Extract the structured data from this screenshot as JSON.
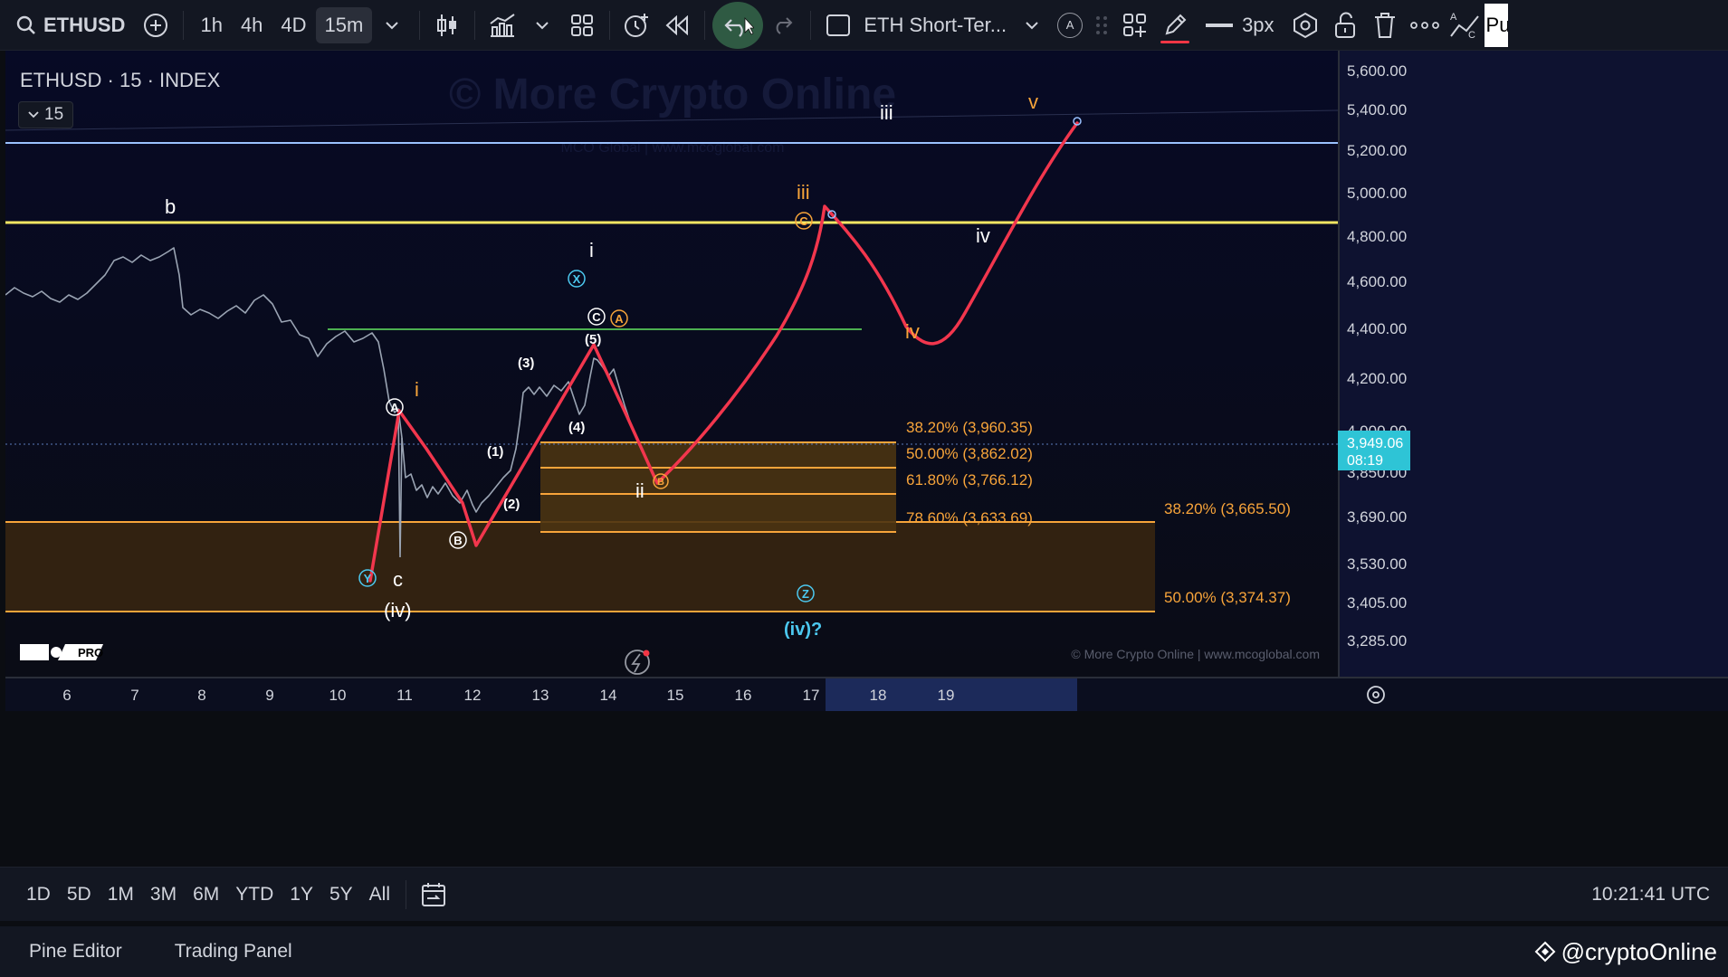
{
  "toolbar": {
    "symbol": "ETHUSD",
    "intervals": [
      "1h",
      "4h",
      "4D",
      "15m"
    ],
    "active_interval": "15m",
    "layout_name": "ETH Short-Ter...",
    "stroke_label": "3px",
    "partial_text": "A",
    "edge_text": "Pu"
  },
  "legend": {
    "title": "ETHUSD · 15 · INDEX",
    "interval_badge": "15"
  },
  "watermark": {
    "main": "© More Crypto Online",
    "sub": "MCO Global  |  www.mcoglobal.com",
    "footer": "© More Crypto Online  |  www.mcoglobal.com"
  },
  "price_axis": {
    "labels": [
      "5,600.00",
      "5,400.00",
      "5,200.00",
      "5,000.00",
      "4,800.00",
      "4,600.00",
      "4,400.00",
      "4,200.00",
      "4,000.00",
      "3,850.00",
      "3,690.00",
      "3,530.00",
      "3,405.00",
      "3,285.00"
    ],
    "current_price": "3,949.06",
    "countdown": "08:19"
  },
  "time_axis": {
    "labels": [
      "6",
      "7",
      "8",
      "9",
      "10",
      "11",
      "12",
      "13",
      "14",
      "15",
      "16",
      "17",
      "18",
      "19"
    ]
  },
  "fib_levels": [
    {
      "label": "38.20% (3,960.35)",
      "price": 3960.35
    },
    {
      "label": "50.00% (3,862.02)",
      "price": 3862.02
    },
    {
      "label": "61.80% (3,766.12)",
      "price": 3766.12
    },
    {
      "label": "78.60% (3,633.69)",
      "price": 3633.69
    }
  ],
  "fib_levels_large": [
    {
      "label": "38.20% (3,665.50)",
      "price": 3665.5
    },
    {
      "label": "50.00% (3,374.37)",
      "price": 3374.37
    }
  ],
  "wave_labels": {
    "b": "b",
    "i_white": "i",
    "iii_white": "iii",
    "v_orange": "v",
    "iii_orange": "iii",
    "iv_white": "iv",
    "iv_orange": "iv",
    "i_orange": "i",
    "ii_white": "ii",
    "c": "c",
    "iv_paren": "(iv)",
    "iv_question": "(iv)?",
    "sub_1": "(1)",
    "sub_2": "(2)",
    "sub_3": "(3)",
    "sub_4": "(4)",
    "sub_5": "(5)",
    "circ_A": "A",
    "circ_B": "B",
    "circ_C": "C",
    "circ_X": "X",
    "circ_Y": "Y",
    "circ_Z": "Z",
    "circ_A_orange": "A",
    "circ_C_orange": "C",
    "circ_B_orange": "B"
  },
  "logo": {
    "badge": "PRO"
  },
  "range_bar": {
    "buttons": [
      "1D",
      "5D",
      "1M",
      "3M",
      "6M",
      "YTD",
      "1Y",
      "5Y",
      "All"
    ],
    "clock": "10:21:41 UTC"
  },
  "bottom_bar": {
    "tabs": [
      "Pine Editor",
      "Trading Panel"
    ],
    "brand": "@cryptoOnline"
  },
  "colors": {
    "bg": "#0b0d12",
    "chart_bg": "#0a0e28",
    "projection": "#f2364d",
    "yellow_line": "#f5e663",
    "blue_line": "#9ac2ff",
    "green_line": "#4caf50",
    "fib_orange": "#f7a43a",
    "cyan": "#4cc9f0",
    "orange_label": "#f7a43a"
  }
}
